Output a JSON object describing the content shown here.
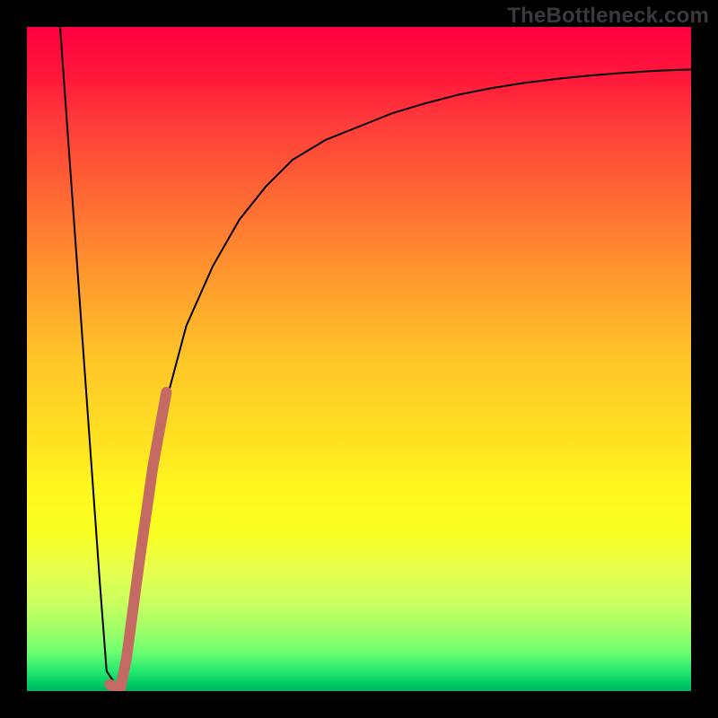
{
  "watermark": "TheBottleneck.com",
  "colors": {
    "curve_black": "#000000",
    "highlight": "#c46a63",
    "frame": "#000000"
  },
  "chart_data": {
    "type": "line",
    "title": "",
    "xlabel": "",
    "ylabel": "",
    "xlim": [
      0,
      100
    ],
    "ylim": [
      0,
      100
    ],
    "grid": false,
    "legend": false,
    "series": [
      {
        "name": "bottleneck-curve",
        "stroke": "#000000",
        "x": [
          5,
          7,
          9,
          11,
          12,
          14,
          15,
          17,
          20,
          24,
          28,
          32,
          36,
          40,
          45,
          50,
          55,
          60,
          65,
          70,
          75,
          80,
          85,
          90,
          95,
          100
        ],
        "y": [
          100,
          72,
          44,
          16,
          3,
          0,
          5,
          20,
          40,
          55,
          64,
          71,
          76,
          80,
          83,
          85,
          87,
          88.5,
          89.8,
          90.8,
          91.6,
          92.2,
          92.7,
          93.1,
          93.4,
          93.6
        ]
      },
      {
        "name": "highlight-segment",
        "stroke": "#c46a63",
        "x": [
          12.5,
          14,
          15,
          17,
          19,
          21
        ],
        "y": [
          1,
          0,
          5,
          20,
          34,
          45
        ]
      }
    ]
  }
}
